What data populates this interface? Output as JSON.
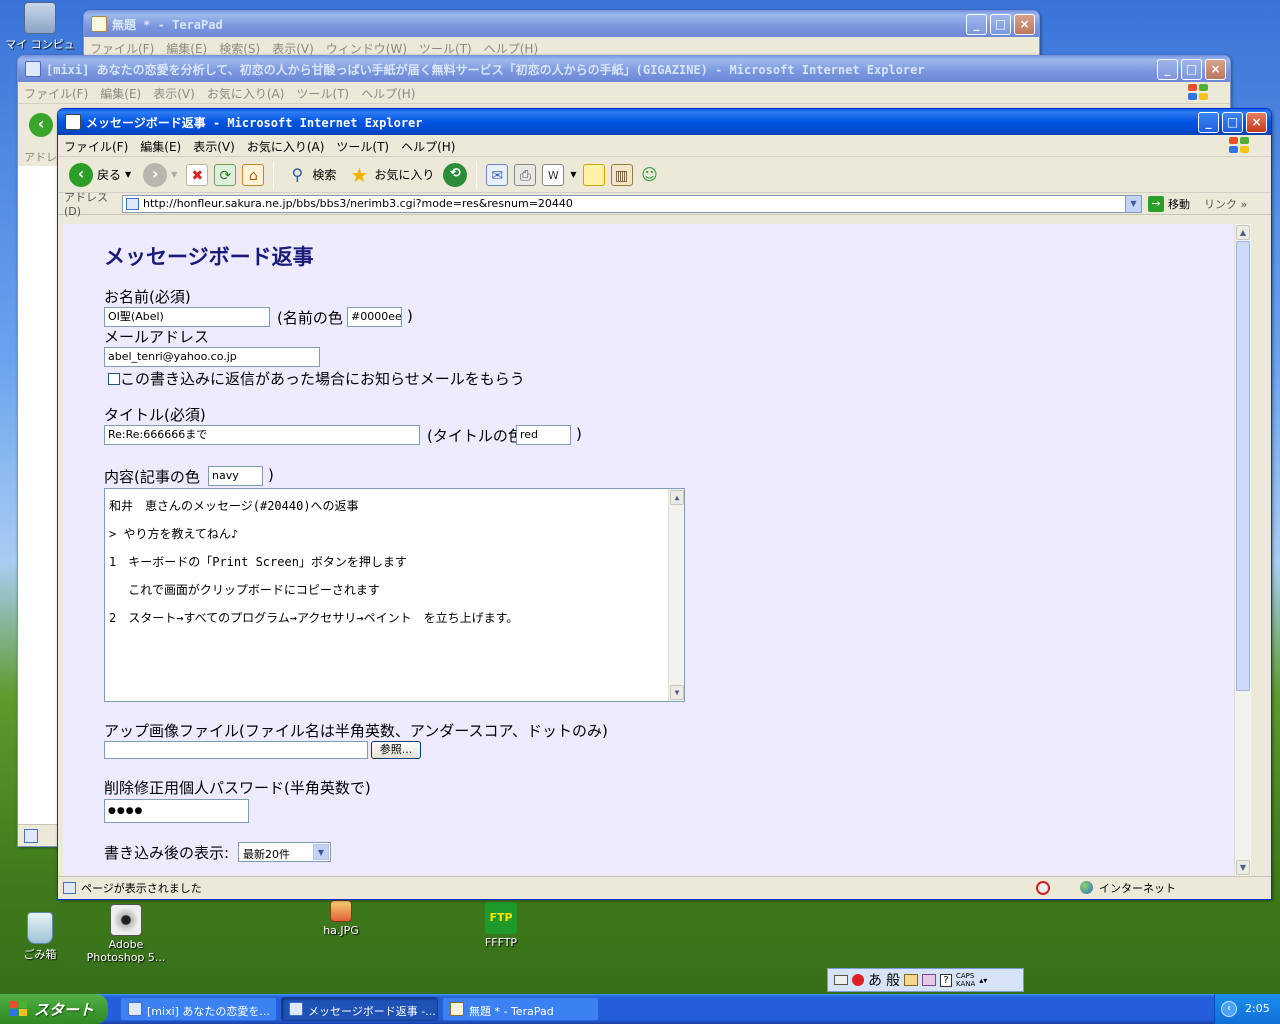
{
  "desktop": {
    "icons": {
      "my_computer": "マイ コンピュータ",
      "recycle": "ごみ箱",
      "photoshop": "Adobe Photoshop 5...",
      "ha_jpg": "ha.JPG",
      "ffftp": "FFFTP"
    }
  },
  "terapad": {
    "title": "無題 * - TeraPad",
    "menu": [
      "ファイル(F)",
      "編集(E)",
      "検索(S)",
      "表示(V)",
      "ウィンドウ(W)",
      "ツール(T)",
      "ヘルプ(H)"
    ]
  },
  "mixi_window": {
    "title": "[mixi] あなたの恋愛を分析して、初恋の人から甘酸っぱい手紙が届く無料サービス「初恋の人からの手紙」(GIGAZINE) - Microsoft Internet Explorer",
    "menu": [
      "ファイル(F)",
      "編集(E)",
      "表示(V)",
      "お気に入り(A)",
      "ツール(T)",
      "ヘルプ(H)"
    ],
    "address_label": "アドレス"
  },
  "ie": {
    "title": "メッセージボード返事 - Microsoft Internet Explorer",
    "menu": [
      "ファイル(F)",
      "編集(E)",
      "表示(V)",
      "お気に入り(A)",
      "ツール(T)",
      "ヘルプ(H)"
    ],
    "toolbar": {
      "back": "戻る",
      "search": "検索",
      "favorites": "お気に入り"
    },
    "address": {
      "label": "アドレス(D)",
      "url": "http://honfleur.sakura.ne.jp/bbs/bbs3/nerimb3.cgi?mode=res&resnum=20440",
      "go": "移動",
      "links": "リンク"
    },
    "status": {
      "text": "ページが表示されました",
      "zone": "インターネット"
    }
  },
  "form": {
    "heading": "メッセージボード返事",
    "name_label": "お名前(必須)",
    "name_value": "OI聖(Abel)",
    "name_color_label_pre": "(名前の色",
    "name_color_value": "#0000ee",
    "name_color_label_post": ")",
    "email_label": "メールアドレス",
    "email_value": "abel_tenri@yahoo.co.jp",
    "notify_label": "この書き込みに返信があった場合にお知らせメールをもらう",
    "title_label": "タイトル(必須)",
    "title_value": "Re:Re:666666まで",
    "title_color_label_pre": "(タイトルの色",
    "title_color_value": "red",
    "title_color_label_post": ")",
    "content_label_pre": "内容(記事の色",
    "content_color_value": "navy",
    "content_label_post": ")",
    "body_lines": [
      "和井　恵さんのメッセージ(#20440)への返事",
      "> やり方を教えてねん♪",
      "1　キーボードの「Print Screen」ボタンを押します",
      "　 これで画面がクリップボードにコピーされます",
      "2　スタート→すべてのプログラム→アクセサリ→ペイント　を立ち上げます。"
    ],
    "upload_label": "アップ画像ファイル(ファイル名は半角英数、アンダースコア、ドットのみ)",
    "browse_button": "参照...",
    "password_label": "削除修正用個人パスワード(半角英数で)",
    "password_value": "●●●●",
    "after_label": "書き込み後の表示:",
    "after_selected": "最新20件"
  },
  "taskbar": {
    "start": "スタート",
    "tasks": [
      "[mixi] あなたの恋愛を...",
      "メッセージボード返事 -...",
      "無題 * - TeraPad"
    ],
    "clock": "2:05"
  },
  "ime": {
    "mode": "あ",
    "conv": "般",
    "caps": "CAPS",
    "kana": "KANA"
  },
  "colors": {
    "xp_title_blue": "#0054e3",
    "page_bg": "#eeeaff",
    "heading": "#1a1a7a"
  }
}
